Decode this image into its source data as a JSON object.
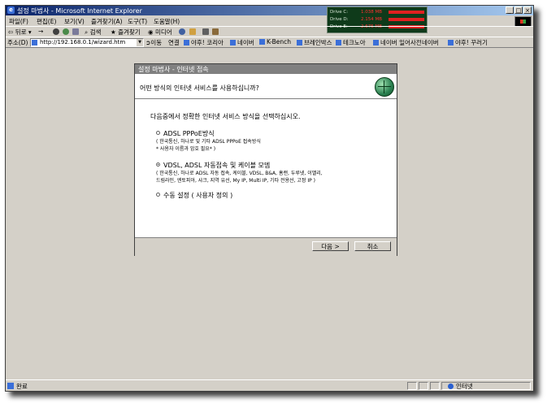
{
  "window": {
    "title": "설정 마법사 - Microsoft Internet Explorer",
    "controls": {
      "minimize": "_",
      "maximize": "□",
      "close": "×"
    }
  },
  "drive_monitor": [
    {
      "name": "Drive C:",
      "value": "1.038 MB"
    },
    {
      "name": "Drive D:",
      "value": "2.154 MB"
    },
    {
      "name": "Drive E:",
      "value": "2.675 MB"
    }
  ],
  "menu": [
    "파일(F)",
    "편집(E)",
    "보기(V)",
    "즐겨찾기(A)",
    "도구(T)",
    "도움말(H)"
  ],
  "toolbar": {
    "back": "뒤로",
    "forward": "→",
    "search": "검색",
    "favorites": "즐겨찾기",
    "media": "미디어"
  },
  "address": {
    "label": "주소(D)",
    "url": "http://192.168.0.1/wizard.htm",
    "go": "이동",
    "links_label": "연결",
    "links": [
      "야후! 코리아",
      "네이버",
      "K-Bench",
      "브레인박스",
      "테크노아",
      "네이버 일어사전",
      "네이버",
      "야후! 꾸러기"
    ]
  },
  "dialog": {
    "title": "설정 마법사 - 인터넷 접속",
    "question": "어떤 방식의 인터넷 서비스를 사용하십니까?",
    "instruction": "다음중에서 정확한 인터넷 서비스 방식을 선택하십시오.",
    "options": [
      {
        "label": "ADSL PPPoE방식",
        "desc1": "( 한국통신, 하나로 및 기타 ADSL PPPoE 접속방식",
        "desc2": "* 사용자 이름과 암호 필요* )"
      },
      {
        "label": "VDSL, ADSL 자동접속 및 케이블 모뎀",
        "desc1": "( 한국통신, 하나로 ADSL 자동 접속, 케이블, VDSL, B&A, 홈랜, 두루넷, 이밸리,",
        "desc2": "드림라인, 엔토피아, 샤크, 지역 유선, My IP, Multi IP, 기타 전용선, 고정 IP )"
      },
      {
        "label": "수동 설정 ( 사용자 정의 )"
      }
    ],
    "next_button": "다음 >",
    "cancel_button": "취소"
  },
  "status": {
    "text": "완료",
    "zone": "인터넷"
  }
}
